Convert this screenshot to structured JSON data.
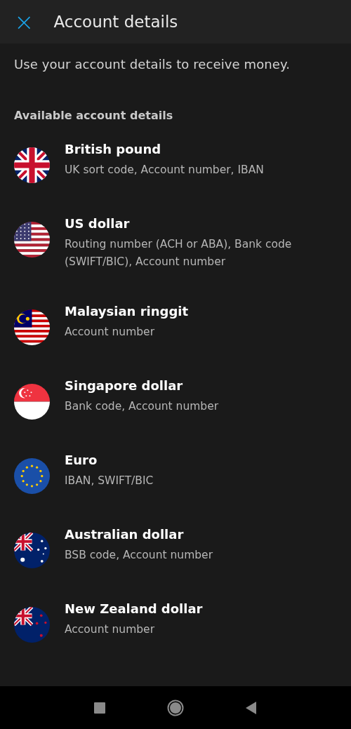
{
  "header": {
    "close_icon": "×",
    "title": "Account details"
  },
  "intro": "Use your account details to receive money.",
  "section_label": "Available account details",
  "currencies": [
    {
      "kind": "gb",
      "name": "British pound",
      "details": "UK sort code, Account number, IBAN"
    },
    {
      "kind": "us",
      "name": "US dollar",
      "details": "Routing number (ACH or ABA), Bank code (SWIFT/BIC), Account number"
    },
    {
      "kind": "my",
      "name": "Malaysian ringgit",
      "details": "Account number"
    },
    {
      "kind": "sg",
      "name": "Singapore dollar",
      "details": "Bank code, Account number"
    },
    {
      "kind": "eu",
      "name": "Euro",
      "details": "IBAN, SWIFT/BIC"
    },
    {
      "kind": "au",
      "name": "Australian dollar",
      "details": "BSB code, Account number"
    },
    {
      "kind": "nz",
      "name": "New Zealand dollar",
      "details": "Account number"
    }
  ]
}
